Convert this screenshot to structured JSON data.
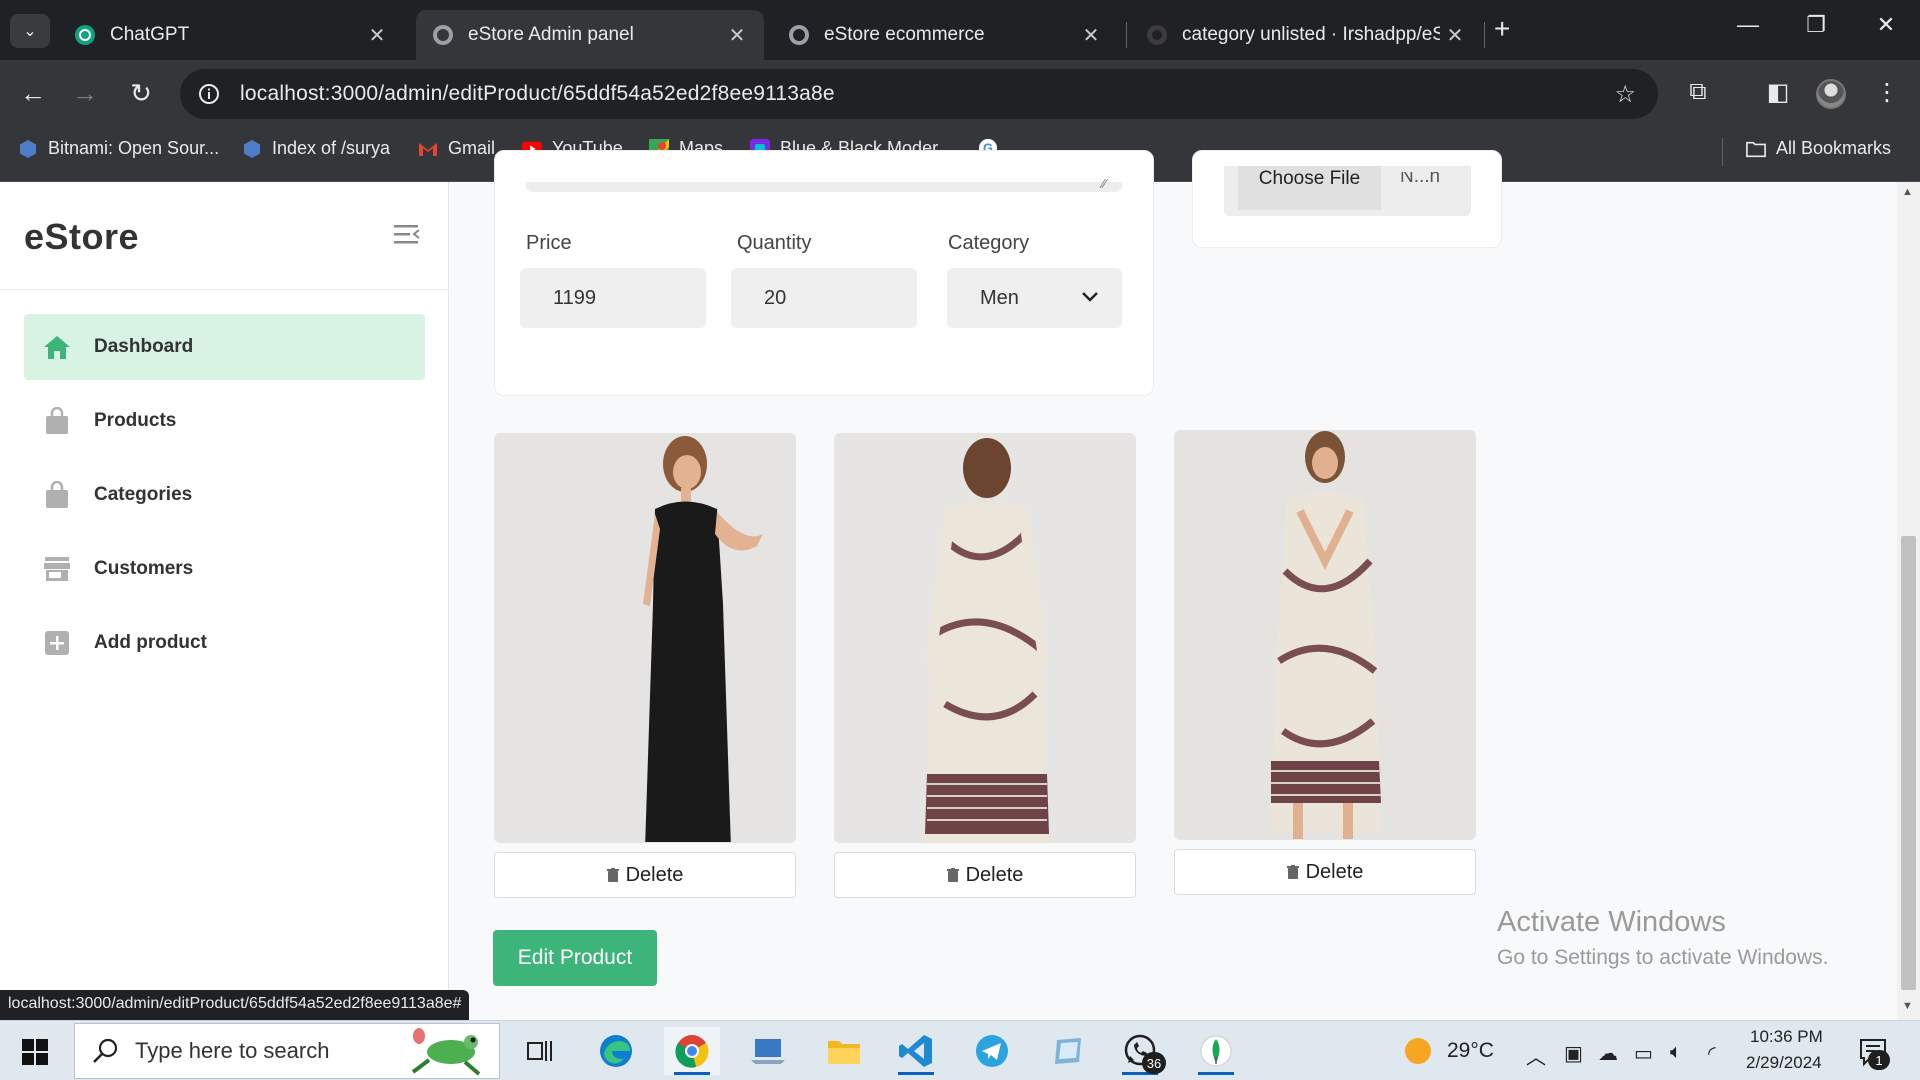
{
  "browser": {
    "tabs": [
      {
        "title": "ChatGPT",
        "active": false
      },
      {
        "title": "eStore Admin panel",
        "active": true
      },
      {
        "title": "eStore ecommerce",
        "active": false
      },
      {
        "title": "category unlisted · Irshadpp/eSt",
        "active": false
      }
    ],
    "url": "localhost:3000/admin/editProduct/65ddf54a52ed2f8ee9113a8e",
    "bookmarks": [
      {
        "label": "Bitnami: Open Sour..."
      },
      {
        "label": "Index of /surya"
      },
      {
        "label": "Gmail"
      },
      {
        "label": "YouTube"
      },
      {
        "label": "Maps"
      },
      {
        "label": "Blue & Black Moder..."
      }
    ],
    "all_bookmarks": "All Bookmarks",
    "status_url": "localhost:3000/admin/editProduct/65ddf54a52ed2f8ee9113a8e#"
  },
  "sidebar": {
    "brand": "eStore",
    "items": [
      {
        "label": "Dashboard",
        "icon": "home-icon",
        "active": true
      },
      {
        "label": "Products",
        "icon": "bag-icon",
        "active": false
      },
      {
        "label": "Categories",
        "icon": "bag-icon",
        "active": false
      },
      {
        "label": "Customers",
        "icon": "store-icon",
        "active": false
      },
      {
        "label": "Add product",
        "icon": "plus-square-icon",
        "active": false
      }
    ]
  },
  "form": {
    "price_label": "Price",
    "price_value": "1199",
    "quantity_label": "Quantity",
    "quantity_value": "20",
    "category_label": "Category",
    "category_value": "Men",
    "file_button": "Choose File",
    "file_name": "N...n"
  },
  "images": [
    {
      "alt": "black sleeveless midi dress",
      "delete_label": "Delete"
    },
    {
      "alt": "patterned dress back view",
      "delete_label": "Delete"
    },
    {
      "alt": "patterned wrap dress front view",
      "delete_label": "Delete"
    }
  ],
  "edit_button": "Edit Product",
  "watermark": {
    "title": "Activate Windows",
    "subtitle": "Go to Settings to activate Windows."
  },
  "taskbar": {
    "search_placeholder": "Type here to search",
    "whatsapp_badge": "36",
    "temperature": "29°C",
    "time": "10:36 PM",
    "date": "2/29/2024",
    "notification_count": "1"
  },
  "colors": {
    "accent": "#3db47a",
    "active_nav_bg": "#d8f3e3",
    "chrome_dark": "#202124"
  }
}
